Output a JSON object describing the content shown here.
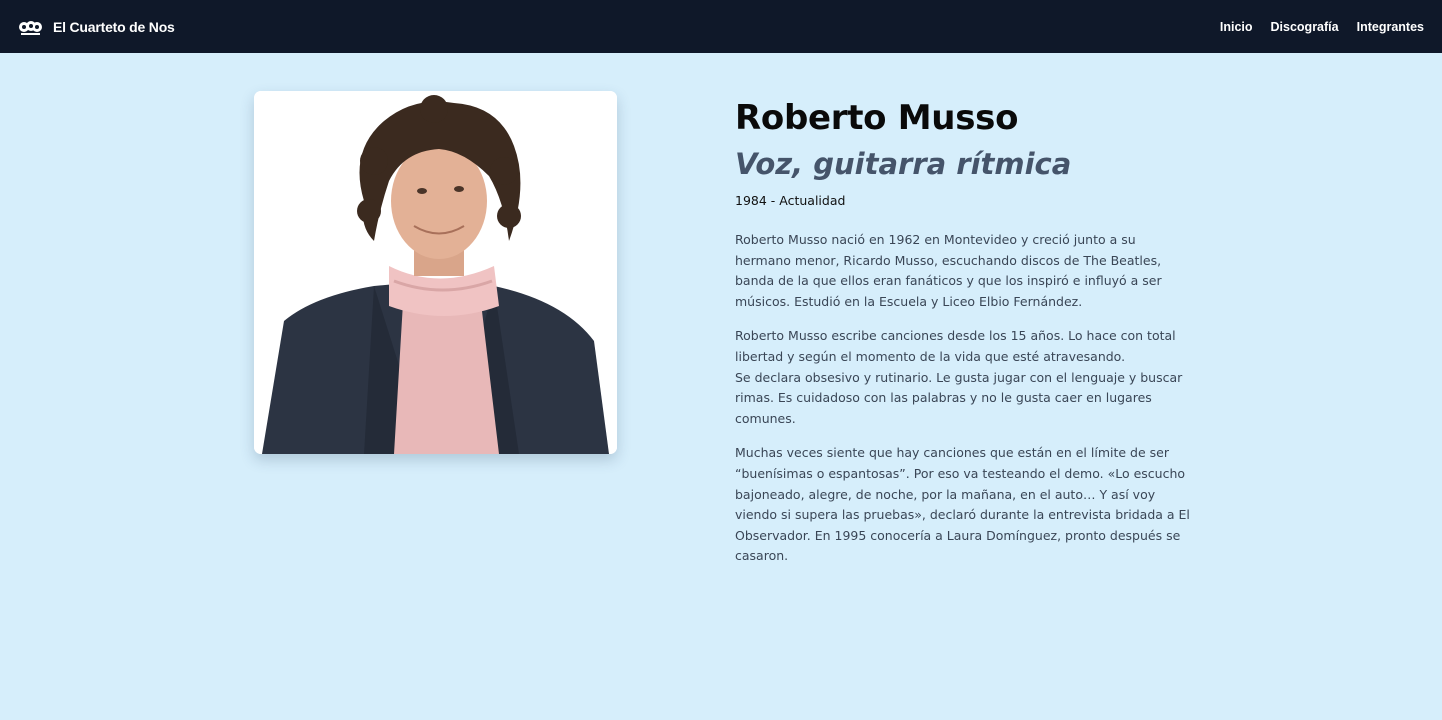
{
  "navbar": {
    "brand": "El Cuarteto de Nos",
    "logo_icon": "band-logo-icon",
    "links": [
      "Inicio",
      "Discografía",
      "Integrantes"
    ]
  },
  "member": {
    "name": "Roberto Musso",
    "role": "Voz, guitarra rítmica",
    "years": "1984 - Actualidad",
    "photo_icon": "member-portrait-photo",
    "bio_p1": "Roberto Musso nació en 1962 en Montevideo y creció junto a su hermano menor, Ricardo Musso, escuchando discos de The Beatles, banda de la que ellos eran fanáticos y que los inspiró e influyó a ser músicos. Estudió en la Escuela y Liceo Elbio Fernández.",
    "bio_p2_line1": "Roberto Musso escribe canciones desde los 15 años. Lo hace con total libertad y según el momento de la vida que esté atravesando.",
    "bio_p2_line2": "Se declara obsesivo y rutinario. Le gusta jugar con el lenguaje y buscar rimas. Es cuidadoso con las palabras y no le gusta caer en lugares comunes.",
    "bio_p3": "Muchas veces siente que hay canciones que están en el límite de ser “buenísimas o espantosas”. Por eso va testeando el demo. «Lo escucho bajoneado, alegre, de noche, por la mañana, en el auto… Y así voy viendo si supera las pruebas», declaró durante la entrevista bridada a El Observador. En 1995 conocería a Laura Domínguez, pronto después se casaron."
  },
  "colors": {
    "navbar_bg": "#0f1829",
    "page_bg": "#d6eefb",
    "role_color": "#45546a"
  }
}
